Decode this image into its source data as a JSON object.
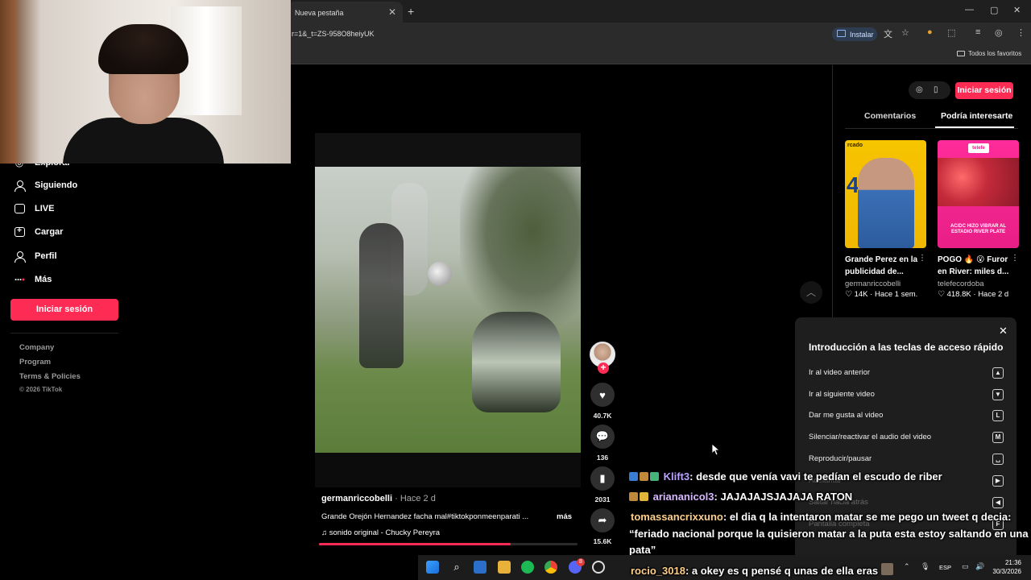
{
  "browser": {
    "tab_title": "Nueva pestaña",
    "tab_close": "✕",
    "new_tab": "+",
    "url": "r=1&_t=ZS-958O8heiyUK",
    "install_label": "Instalar",
    "favorites_label": "Todos los favoritos",
    "window_controls": [
      "—",
      "▢",
      "✕"
    ]
  },
  "sidebar": {
    "items": [
      {
        "label": "Explorar",
        "icon": "compass-icon"
      },
      {
        "label": "Siguiendo",
        "icon": "users-icon"
      },
      {
        "label": "LIVE",
        "icon": "tv-icon"
      },
      {
        "label": "Cargar",
        "icon": "plus-square-icon"
      },
      {
        "label": "Perfil",
        "icon": "user-icon"
      },
      {
        "label": "Más",
        "icon": "more-dots-icon"
      }
    ],
    "login_label": "Iniciar sesión",
    "footer_links": [
      "Company",
      "Program",
      "Terms & Policies"
    ],
    "copyright": "© 2026 TikTok"
  },
  "video": {
    "author": "germanriccobelli",
    "posted": " · Hace 2 d",
    "description": "Grande Orejón Hernandez facha mal#tiktokponmeenparati ...",
    "more_label": "más",
    "sound": "♫  sonido original - Chucky Pereyra",
    "progress": 0.74,
    "actions": {
      "likes": "40.7K",
      "comments": "136",
      "saves": "2031",
      "shares": "15.6K"
    }
  },
  "right_panel": {
    "login_label": "Iniciar sesión",
    "tabs": [
      "Comentarios",
      "Podría interesarte"
    ],
    "cards": [
      {
        "title": "Grande Perez en la publicidad de...",
        "user": "germanriccobelli",
        "likes": "14K",
        "age": "Hace 1 sem.",
        "tag": "rcado",
        "jersey": "4"
      },
      {
        "title": "POGO 🔥 😮 Furor en River: miles d...",
        "user": "telefecordoba",
        "likes": "418.8K",
        "age": "Hace 2 d",
        "logo": "telefe",
        "overlay": "AC/DC HIZO VIBRAR AL ESTADIO RIVER PLATE"
      }
    ]
  },
  "shortcuts": {
    "title": "Introducción a las teclas de acceso rápido",
    "rows": [
      {
        "label": "Ir al video anterior",
        "key": "▲"
      },
      {
        "label": "Ir al siguiente video",
        "key": "▼"
      },
      {
        "label": "Dar me gusta al video",
        "key": "L"
      },
      {
        "label": "Silenciar/reactivar el audio del video",
        "key": "M"
      },
      {
        "label": "Reproducir/pausar",
        "key": "␣"
      },
      {
        "label": "Adelantar",
        "key": "▶"
      },
      {
        "label": "Saltar hacia atrás",
        "key": "◀"
      },
      {
        "label": "Pantalla completa",
        "key": "F"
      }
    ]
  },
  "chat": [
    {
      "user": "Klift3",
      "user_color": "#b9a3ff",
      "text": ": desde que venía vavi te pedían el escudo de riber"
    },
    {
      "user": "ariananicol3",
      "user_color": "#d7b9ff",
      "text": ": JAJAJAJSJAJAJA RATON"
    },
    {
      "user": "tomassancrixxuno",
      "user_color": "#ffcf8a",
      "text": ": el dia q la intentaron matar se me pego un tweet q decia:"
    },
    {
      "user": "",
      "user_color": "#ffffff",
      "text": "“feriado nacional porque la quisieron matar a la puta esta estoy saltando en una"
    },
    {
      "user": "",
      "user_color": "#ffffff",
      "text": "pata”"
    },
    {
      "user": "rocio_3018",
      "user_color": "#ffcf8a",
      "text": ": a okey es q pensé q unas de ella eras"
    }
  ],
  "taskbar": {
    "time": "21:36",
    "date": "30/3/2026",
    "lang": "ESP",
    "discord_badge": "8"
  },
  "colors": {
    "accent": "#fe2c55",
    "card_pink": "#e81f86",
    "card_yellow": "#f7c400"
  }
}
